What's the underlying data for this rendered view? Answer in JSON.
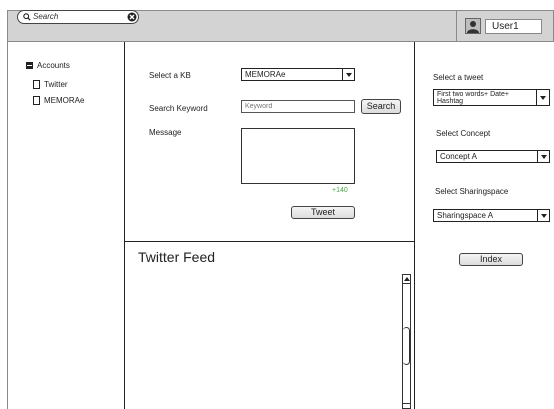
{
  "topbar": {
    "search_placeholder": "Search",
    "username": "User1"
  },
  "sidebar": {
    "root_label": "Accounts",
    "items": [
      {
        "label": "Twitter"
      },
      {
        "label": "MEMORAe"
      }
    ]
  },
  "compose": {
    "kb_label": "Select a KB",
    "kb_value": "MEMORAe",
    "keyword_label": "Search Keyword",
    "keyword_placeholder": "Keyword",
    "search_button": "Search",
    "message_label": "Message",
    "char_count": "+140",
    "tweet_button": "Tweet"
  },
  "feed": {
    "title": "Twitter Feed"
  },
  "rightpanel": {
    "tweet_label": "Select a tweet",
    "tweet_value": "First two words+ Date+ Hashtag",
    "concept_label": "Select Concept",
    "concept_value": "Concept A",
    "sharing_label": "Select Sharingspace",
    "sharing_value": "Sharingspace A",
    "index_button": "Index"
  },
  "colors": {
    "topbar_bg": "#d3d3d3",
    "char_count": "#4aa84a"
  },
  "icons": [
    "search-icon",
    "clear-icon",
    "user-avatar-icon",
    "collapse-icon",
    "document-icon",
    "chevron-down-icon",
    "scroll-up-icon"
  ]
}
